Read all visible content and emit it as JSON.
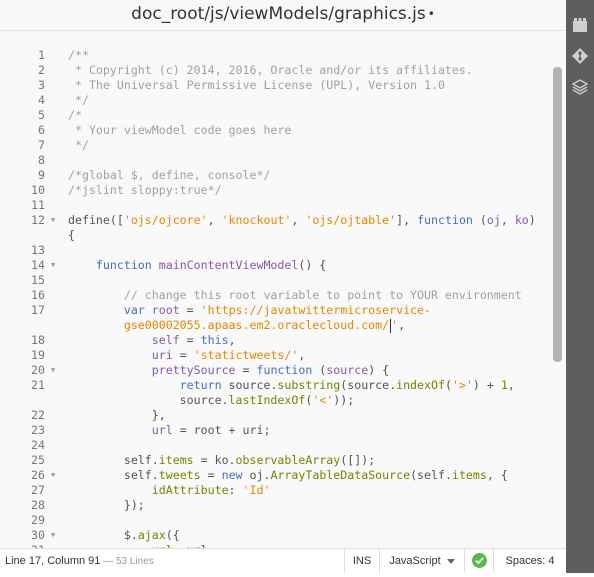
{
  "title": {
    "filename": "doc_root/js/viewModels/graphics.js",
    "dirty_marker": "•"
  },
  "editor": {
    "lines": [
      {
        "n": "1",
        "fold": false,
        "tokens": [
          [
            "comment",
            "/**"
          ]
        ]
      },
      {
        "n": "2",
        "fold": false,
        "tokens": [
          [
            "comment",
            " * Copyright (c) 2014, 2016, Oracle and/or its affiliates."
          ]
        ]
      },
      {
        "n": "3",
        "fold": false,
        "tokens": [
          [
            "comment",
            " * The Universal Permissive License (UPL), Version 1.0"
          ]
        ]
      },
      {
        "n": "4",
        "fold": false,
        "tokens": [
          [
            "comment",
            " */"
          ]
        ]
      },
      {
        "n": "5",
        "fold": false,
        "tokens": [
          [
            "comment",
            "/*"
          ]
        ]
      },
      {
        "n": "6",
        "fold": false,
        "tokens": [
          [
            "comment",
            " * Your viewModel code goes here"
          ]
        ]
      },
      {
        "n": "7",
        "fold": false,
        "tokens": [
          [
            "comment",
            " */"
          ]
        ]
      },
      {
        "n": "8",
        "fold": false,
        "tokens": []
      },
      {
        "n": "9",
        "fold": false,
        "tokens": [
          [
            "comment",
            "/*global $, define, console*/"
          ]
        ]
      },
      {
        "n": "10",
        "fold": false,
        "tokens": [
          [
            "comment",
            "/*jslint sloppy:true*/"
          ]
        ]
      },
      {
        "n": "11",
        "fold": false,
        "tokens": []
      },
      {
        "n": "12",
        "fold": true,
        "tokens": [
          [
            "plain",
            "define(["
          ],
          [
            "string",
            "'ojs/ojcore'"
          ],
          [
            "plain",
            ", "
          ],
          [
            "string",
            "'knockout'"
          ],
          [
            "plain",
            ", "
          ],
          [
            "string",
            "'ojs/ojtable'"
          ],
          [
            "plain",
            "], "
          ],
          [
            "keyword",
            "function"
          ],
          [
            "plain",
            " ("
          ],
          [
            "def",
            "oj"
          ],
          [
            "plain",
            ", "
          ],
          [
            "def",
            "ko"
          ],
          [
            "plain",
            ")"
          ]
        ]
      },
      {
        "n": "",
        "fold": false,
        "tokens": [
          [
            "plain",
            "{"
          ]
        ]
      },
      {
        "n": "13",
        "fold": false,
        "tokens": []
      },
      {
        "n": "14",
        "fold": true,
        "tokens": [
          [
            "plain",
            "    "
          ],
          [
            "keyword",
            "function"
          ],
          [
            "plain",
            " "
          ],
          [
            "def",
            "mainContentViewModel"
          ],
          [
            "plain",
            "() {"
          ]
        ]
      },
      {
        "n": "15",
        "fold": false,
        "tokens": []
      },
      {
        "n": "16",
        "fold": false,
        "tokens": [
          [
            "plain",
            "        "
          ],
          [
            "comment",
            "// change this root variable to point to YOUR environment"
          ]
        ]
      },
      {
        "n": "17",
        "fold": false,
        "tokens": [
          [
            "plain",
            "        "
          ],
          [
            "keyword",
            "var"
          ],
          [
            "plain",
            " "
          ],
          [
            "def",
            "root"
          ],
          [
            "plain",
            " = "
          ],
          [
            "string",
            "'https://javatwittermicroservice-"
          ]
        ]
      },
      {
        "n": "",
        "fold": false,
        "tokens": [
          [
            "plain",
            "        "
          ],
          [
            "string",
            "gse00002055.apaas.em2.oraclecloud.com/"
          ],
          [
            "cursor",
            ""
          ],
          [
            "string",
            "'"
          ],
          [
            "plain",
            ","
          ]
        ]
      },
      {
        "n": "18",
        "fold": false,
        "tokens": [
          [
            "plain",
            "            "
          ],
          [
            "def",
            "self"
          ],
          [
            "plain",
            " = "
          ],
          [
            "keyword",
            "this"
          ],
          [
            "plain",
            ","
          ]
        ]
      },
      {
        "n": "19",
        "fold": false,
        "tokens": [
          [
            "plain",
            "            "
          ],
          [
            "def",
            "uri"
          ],
          [
            "plain",
            " = "
          ],
          [
            "string",
            "'statictweets/'"
          ],
          [
            "plain",
            ","
          ]
        ]
      },
      {
        "n": "20",
        "fold": true,
        "tokens": [
          [
            "plain",
            "            "
          ],
          [
            "def",
            "prettySource"
          ],
          [
            "plain",
            " = "
          ],
          [
            "keyword",
            "function"
          ],
          [
            "plain",
            " ("
          ],
          [
            "def",
            "source"
          ],
          [
            "plain",
            ") {"
          ]
        ]
      },
      {
        "n": "21",
        "fold": false,
        "tokens": [
          [
            "plain",
            "                "
          ],
          [
            "keyword",
            "return"
          ],
          [
            "plain",
            " source."
          ],
          [
            "prop",
            "substring"
          ],
          [
            "plain",
            "(source."
          ],
          [
            "prop",
            "indexOf"
          ],
          [
            "plain",
            "("
          ],
          [
            "string",
            "'>'"
          ],
          [
            "plain",
            ") + "
          ],
          [
            "num",
            "1"
          ],
          [
            "plain",
            ","
          ]
        ]
      },
      {
        "n": "",
        "fold": false,
        "tokens": [
          [
            "plain",
            "                source."
          ],
          [
            "prop",
            "lastIndexOf"
          ],
          [
            "plain",
            "("
          ],
          [
            "string",
            "'<'"
          ],
          [
            "plain",
            "));"
          ]
        ]
      },
      {
        "n": "22",
        "fold": false,
        "tokens": [
          [
            "plain",
            "            },"
          ]
        ]
      },
      {
        "n": "23",
        "fold": false,
        "tokens": [
          [
            "plain",
            "            "
          ],
          [
            "def",
            "url"
          ],
          [
            "plain",
            " = root + uri;"
          ]
        ]
      },
      {
        "n": "24",
        "fold": false,
        "tokens": []
      },
      {
        "n": "25",
        "fold": false,
        "tokens": [
          [
            "plain",
            "        self."
          ],
          [
            "prop",
            "items"
          ],
          [
            "plain",
            " = ko."
          ],
          [
            "prop",
            "observableArray"
          ],
          [
            "plain",
            "([]);"
          ]
        ]
      },
      {
        "n": "26",
        "fold": true,
        "tokens": [
          [
            "plain",
            "        self."
          ],
          [
            "prop",
            "tweets"
          ],
          [
            "plain",
            " = "
          ],
          [
            "keyword",
            "new"
          ],
          [
            "plain",
            " oj."
          ],
          [
            "prop",
            "ArrayTableDataSource"
          ],
          [
            "plain",
            "(self."
          ],
          [
            "prop",
            "items"
          ],
          [
            "plain",
            ", {"
          ]
        ]
      },
      {
        "n": "27",
        "fold": false,
        "tokens": [
          [
            "plain",
            "            "
          ],
          [
            "prop",
            "idAttribute"
          ],
          [
            "plain",
            ": "
          ],
          [
            "string",
            "'Id'"
          ]
        ]
      },
      {
        "n": "28",
        "fold": false,
        "tokens": [
          [
            "plain",
            "        });"
          ]
        ]
      },
      {
        "n": "29",
        "fold": false,
        "tokens": []
      },
      {
        "n": "30",
        "fold": true,
        "tokens": [
          [
            "plain",
            "        $."
          ],
          [
            "prop",
            "ajax"
          ],
          [
            "plain",
            "({"
          ]
        ]
      },
      {
        "n": "31",
        "fold": false,
        "tokens": [
          [
            "plain",
            "            "
          ],
          [
            "prop",
            "url"
          ],
          [
            "plain",
            ": url,"
          ]
        ]
      }
    ]
  },
  "statusbar": {
    "position": "Line 17, Column 91",
    "line_count": " — 53 Lines",
    "mode": "INS",
    "language": "JavaScript",
    "spaces": "Spaces: 4"
  },
  "toolbar": {
    "icons": [
      "extension-manager-icon",
      "git-icon",
      "layers-icon"
    ]
  },
  "colors": {
    "string": "#e88501",
    "keyword": "#446fbd",
    "definition": "#8757ad",
    "property": "#6d8600",
    "comment": "#a0a0a0",
    "lint_ok": "#5bb84e"
  }
}
